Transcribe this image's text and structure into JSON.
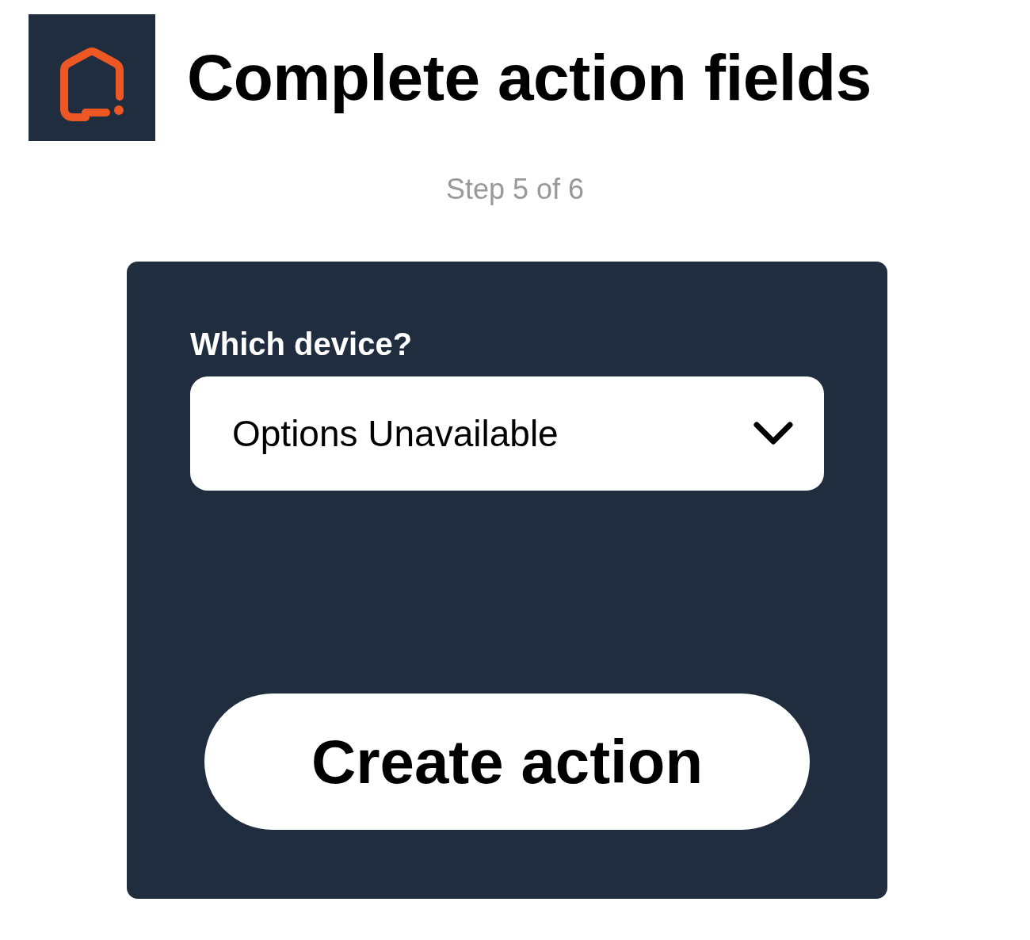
{
  "header": {
    "title": "Complete action fields",
    "step": "Step 5 of 6"
  },
  "form": {
    "field_label": "Which device?",
    "select_value": "Options Unavailable",
    "submit": "Create action"
  }
}
